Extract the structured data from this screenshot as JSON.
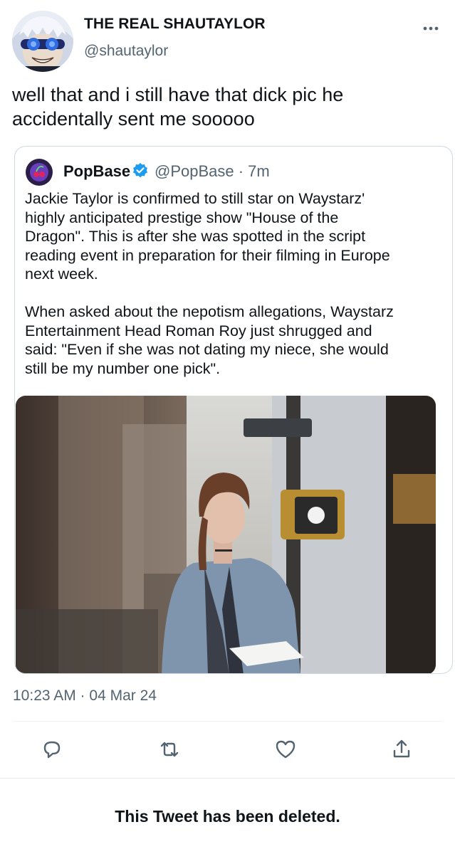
{
  "tweet": {
    "display_name": "THE REAL SHAUTAYLOR",
    "handle": "@shautaylor",
    "text": "well that and i still have that dick pic he\naccidentally sent me sooooo",
    "timestamp": "10:23 AM · 04 Mar 24"
  },
  "quote": {
    "name": "PopBase",
    "handle_time": "@PopBase · 7m",
    "text": "Jackie Taylor is confirmed to still star on Waystarz'\nhighly anticipated prestige show \"House of the\nDragon\". This is after she was spotted in the script\nreading event in preparation for their filming in Europe\nnext week.\n\nWhen asked about the nepotism allegations, Waystarz\nEntertainment  Head Roman Roy just shrugged and\nsaid: \"Even if she was not dating my niece, she would\nstill be my number one pick\"."
  },
  "icons": [
    "more-icon",
    "verified-icon",
    "reply-icon",
    "retweet-icon",
    "like-icon",
    "share-icon"
  ],
  "colors": {
    "verified": "#1d9bf0",
    "secondary_text": "#536471",
    "border": "#cfd9de"
  },
  "status": {
    "deleted_text": "This Tweet has been deleted."
  }
}
